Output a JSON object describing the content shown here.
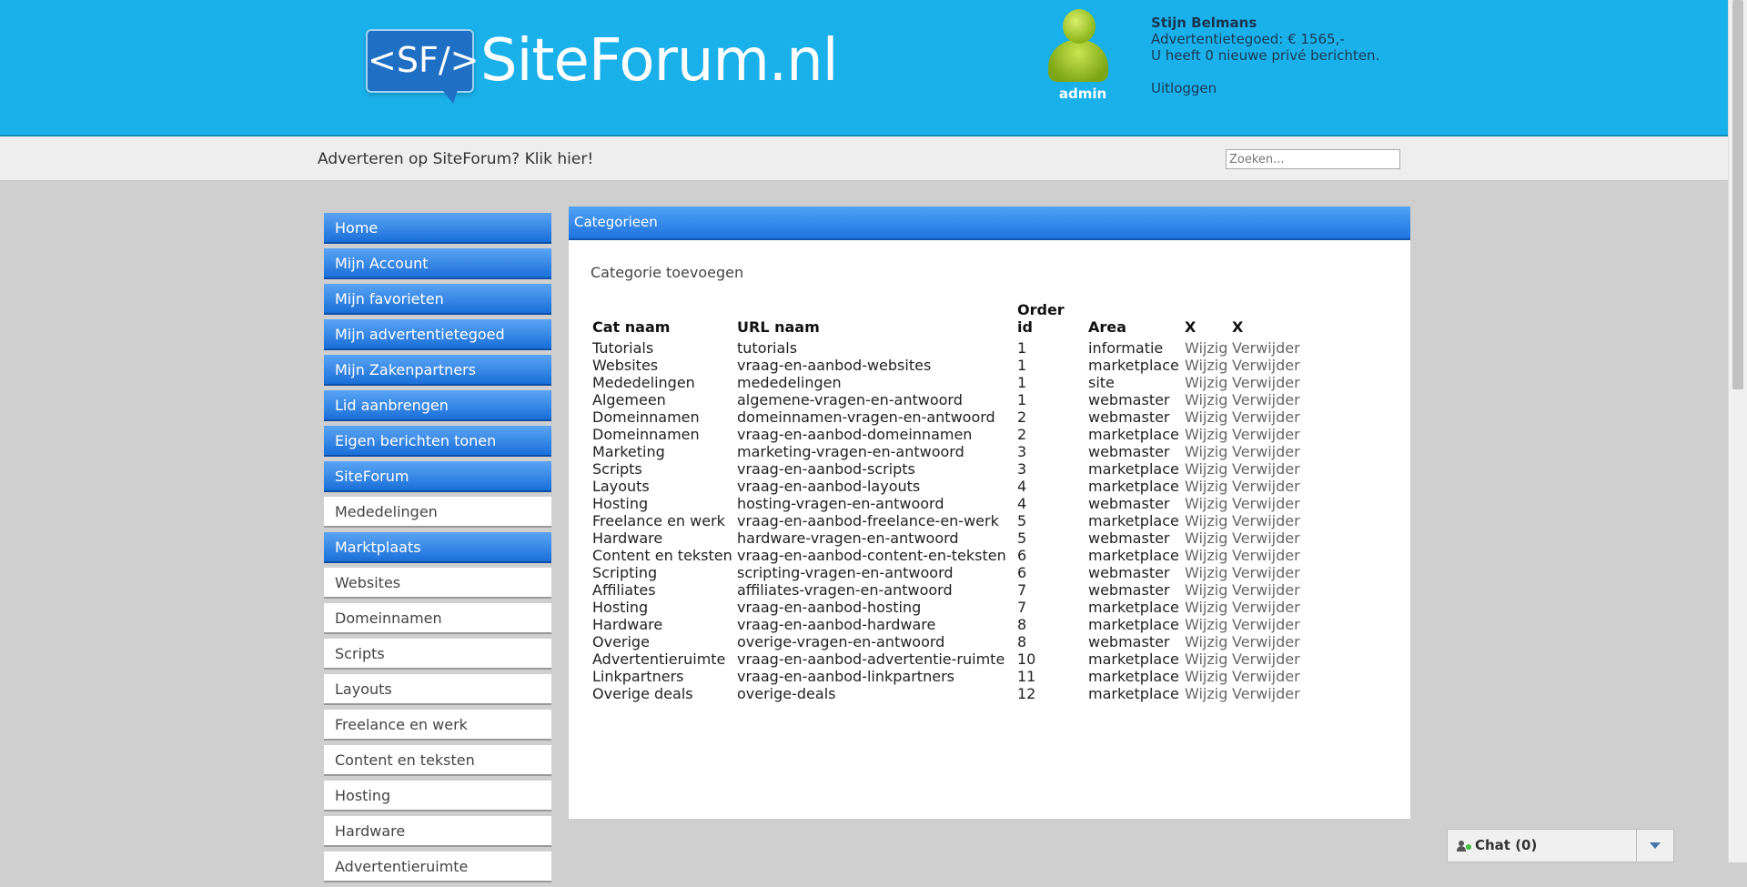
{
  "header": {
    "logo_mark": "<SF/>",
    "logo_text": "SiteForum.nl",
    "avatar_name": "admin",
    "user_name": "Stijn Belmans",
    "credit": "Advertentietegoed: € 1565,-",
    "messages": "U heeft 0 nieuwe privé berichten.",
    "logout": "Uitloggen"
  },
  "bar": {
    "ad_text": "Adverteren op SiteForum? Klik hier!",
    "search_placeholder": "Zoeken..."
  },
  "sidebar": {
    "items": [
      {
        "label": "Home",
        "style": "blue"
      },
      {
        "label": "Mijn Account",
        "style": "blue"
      },
      {
        "label": "Mijn favorieten",
        "style": "blue"
      },
      {
        "label": "Mijn advertentietegoed",
        "style": "blue"
      },
      {
        "label": "Mijn Zakenpartners",
        "style": "blue"
      },
      {
        "label": "Lid aanbrengen",
        "style": "blue"
      },
      {
        "label": "Eigen berichten tonen",
        "style": "blue"
      },
      {
        "label": "SiteForum",
        "style": "blue"
      },
      {
        "label": "Mededelingen",
        "style": "white"
      },
      {
        "label": "Marktplaats",
        "style": "blue"
      },
      {
        "label": "Websites",
        "style": "white"
      },
      {
        "label": "Domeinnamen",
        "style": "white"
      },
      {
        "label": "Scripts",
        "style": "white"
      },
      {
        "label": "Layouts",
        "style": "white"
      },
      {
        "label": "Freelance en werk",
        "style": "white"
      },
      {
        "label": "Content en teksten",
        "style": "white"
      },
      {
        "label": "Hosting",
        "style": "white"
      },
      {
        "label": "Hardware",
        "style": "white"
      },
      {
        "label": "Advertentieruimte",
        "style": "white"
      }
    ]
  },
  "main": {
    "panel_title": "Categorieen",
    "add_link": "Categorie toevoegen",
    "columns": [
      "Cat naam",
      "URL naam",
      "Order id",
      "Area",
      "X",
      "X"
    ],
    "rows": [
      [
        "Tutorials",
        "tutorials",
        "1",
        "informatie"
      ],
      [
        "Websites",
        "vraag-en-aanbod-websites",
        "1",
        "marketplace"
      ],
      [
        "Mededelingen",
        "mededelingen",
        "1",
        "site"
      ],
      [
        "Algemeen",
        "algemene-vragen-en-antwoord",
        "1",
        "webmaster"
      ],
      [
        "Domeinnamen",
        "domeinnamen-vragen-en-antwoord",
        "2",
        "webmaster"
      ],
      [
        "Domeinnamen",
        "vraag-en-aanbod-domeinnamen",
        "2",
        "marketplace"
      ],
      [
        "Marketing",
        "marketing-vragen-en-antwoord",
        "3",
        "webmaster"
      ],
      [
        "Scripts",
        "vraag-en-aanbod-scripts",
        "3",
        "marketplace"
      ],
      [
        "Layouts",
        "vraag-en-aanbod-layouts",
        "4",
        "marketplace"
      ],
      [
        "Hosting",
        "hosting-vragen-en-antwoord",
        "4",
        "webmaster"
      ],
      [
        "Freelance en werk",
        "vraag-en-aanbod-freelance-en-werk",
        "5",
        "marketplace"
      ],
      [
        "Hardware",
        "hardware-vragen-en-antwoord",
        "5",
        "webmaster"
      ],
      [
        "Content en teksten",
        "vraag-en-aanbod-content-en-teksten",
        "6",
        "marketplace"
      ],
      [
        "Scripting",
        "scripting-vragen-en-antwoord",
        "6",
        "webmaster"
      ],
      [
        "Affiliates",
        "affiliates-vragen-en-antwoord",
        "7",
        "webmaster"
      ],
      [
        "Hosting",
        "vraag-en-aanbod-hosting",
        "7",
        "marketplace"
      ],
      [
        "Hardware",
        "vraag-en-aanbod-hardware",
        "8",
        "marketplace"
      ],
      [
        "Overige",
        "overige-vragen-en-antwoord",
        "8",
        "webmaster"
      ],
      [
        "Advertentieruimte",
        "vraag-en-aanbod-advertentie-ruimte",
        "10",
        "marketplace"
      ],
      [
        "Linkpartners",
        "vraag-en-aanbod-linkpartners",
        "11",
        "marketplace"
      ],
      [
        "Overige deals",
        "overige-deals",
        "12",
        "marketplace"
      ]
    ],
    "edit_label": "Wijzig",
    "delete_label": "Verwijder"
  },
  "chat": {
    "label": "Chat (0)"
  },
  "colors": {
    "header_bg": "#1ab0ea",
    "nav_blue": "#1a6fd8",
    "panel_head": "#1f73df"
  }
}
